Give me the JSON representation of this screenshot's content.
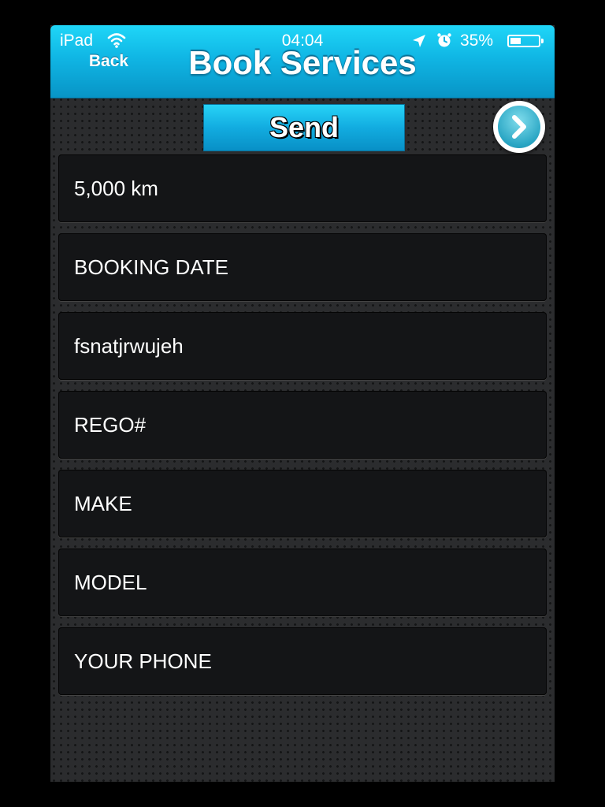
{
  "status_bar": {
    "carrier": "iPad",
    "time": "04:04",
    "battery_percent": "35%",
    "battery_level": 0.35,
    "icons": [
      "wifi-icon",
      "location-icon",
      "alarm-icon",
      "battery-icon"
    ]
  },
  "nav": {
    "back_label": "Back",
    "title": "Book Services"
  },
  "actions": {
    "send_label": "Send",
    "next_icon": "chevron-right-icon"
  },
  "form": {
    "fields": [
      {
        "value": "5,000 km"
      },
      {
        "value": "BOOKING DATE"
      },
      {
        "value": "fsnatjrwujeh"
      },
      {
        "value": "REGO#"
      },
      {
        "value": "MAKE"
      },
      {
        "value": "MODEL"
      },
      {
        "value": "YOUR PHONE"
      }
    ]
  },
  "colors": {
    "accent": "#12ace0",
    "background": "#2b2c2e",
    "field": "#141517"
  }
}
